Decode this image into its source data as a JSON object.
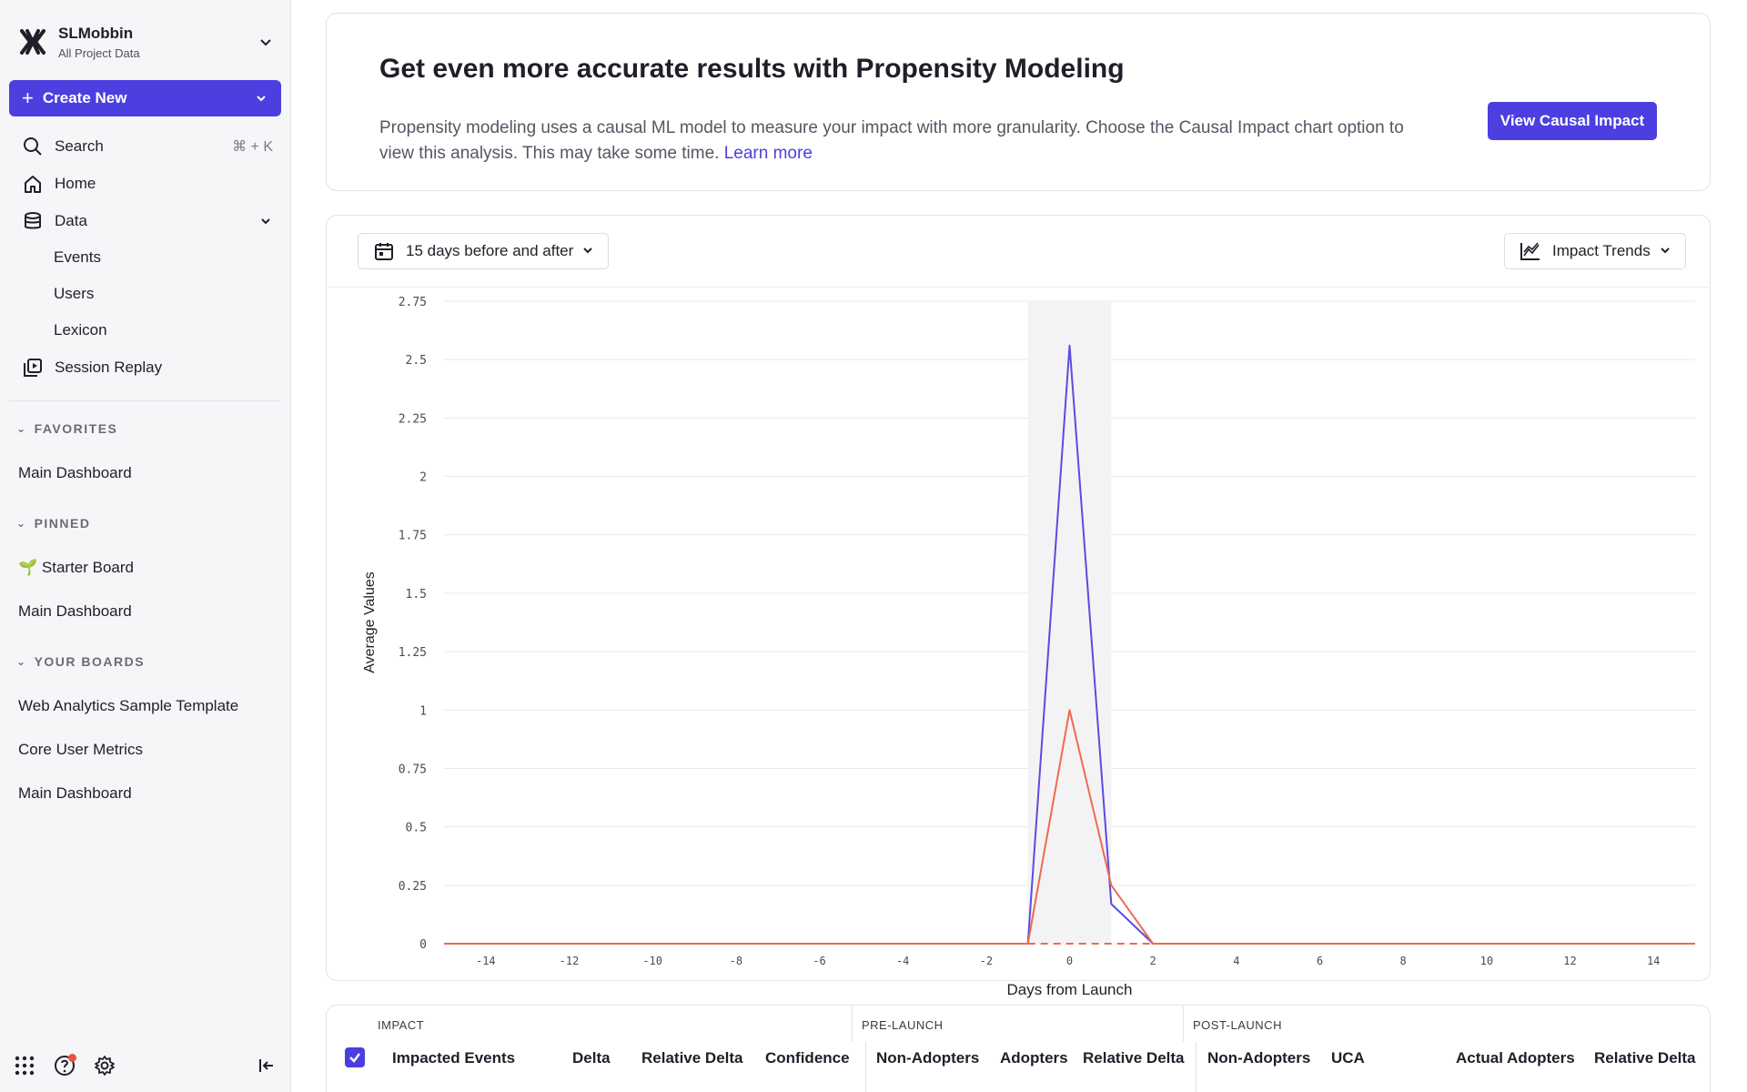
{
  "sidebar": {
    "project_name": "SLMobbin",
    "project_sub": "All Project Data",
    "create_label": "Create New",
    "nav": [
      {
        "label": "Search",
        "shortcut": "⌘ + K",
        "icon": "search-icon"
      },
      {
        "label": "Home",
        "icon": "home-icon"
      },
      {
        "label": "Data",
        "icon": "database-icon"
      }
    ],
    "data_sub": [
      "Events",
      "Users",
      "Lexicon"
    ],
    "session_replay": "Session Replay",
    "favorites_title": "FAVORITES",
    "favorites": [
      "Main Dashboard"
    ],
    "pinned_title": "PINNED",
    "pinned": [
      "🌱 Starter Board",
      "Main Dashboard"
    ],
    "boards_title": "YOUR BOARDS",
    "boards": [
      "Web Analytics Sample Template",
      "Core User Metrics",
      "Main Dashboard"
    ]
  },
  "banner": {
    "title": "Get even more accurate results with Propensity Modeling",
    "body": "Propensity modeling uses a causal ML model to measure your impact with more granularity. Choose the Causal Impact chart option to view this analysis. This may take some time.",
    "link": "Learn more",
    "button": "View Causal Impact"
  },
  "controls": {
    "range": "15 days before and after",
    "view": "Impact Trends"
  },
  "chart_data": {
    "type": "line",
    "ylabel": "Average Values",
    "xlabel": "Days from Launch",
    "ylim": [
      0,
      2.75
    ],
    "xlim": [
      -15,
      15
    ],
    "yticks": [
      "0",
      "0.25",
      "0.5",
      "0.75",
      "1",
      "1.25",
      "1.5",
      "1.75",
      "2",
      "2.25",
      "2.5",
      "2.75"
    ],
    "xticks": [
      "-14",
      "-12",
      "-10",
      "-8",
      "-6",
      "-4",
      "-2",
      "0",
      "2",
      "4",
      "6",
      "8",
      "10",
      "12",
      "14"
    ],
    "highlight_range": [
      -1,
      1
    ],
    "grid": true,
    "series": [
      {
        "color": "#5b4be0",
        "x": [
          -15,
          -1,
          0,
          1,
          2,
          15
        ],
        "values": [
          0,
          0,
          2.56,
          0.17,
          0,
          0
        ]
      },
      {
        "color": "#ef6a4c",
        "x": [
          -15,
          -1,
          0,
          1,
          2,
          15
        ],
        "values": [
          0,
          0,
          1.0,
          0.25,
          0,
          0
        ]
      }
    ]
  },
  "table": {
    "groups": [
      "IMPACT",
      "PRE-LAUNCH",
      "POST-LAUNCH"
    ],
    "headers": [
      "Impacted Events",
      "Delta",
      "Relative Delta",
      "Confidence",
      "Non-Adopters",
      "Adopters",
      "Relative Delta",
      "Non-Adopters",
      "UCA",
      "Actual Adopters",
      "Relative Delta"
    ]
  }
}
